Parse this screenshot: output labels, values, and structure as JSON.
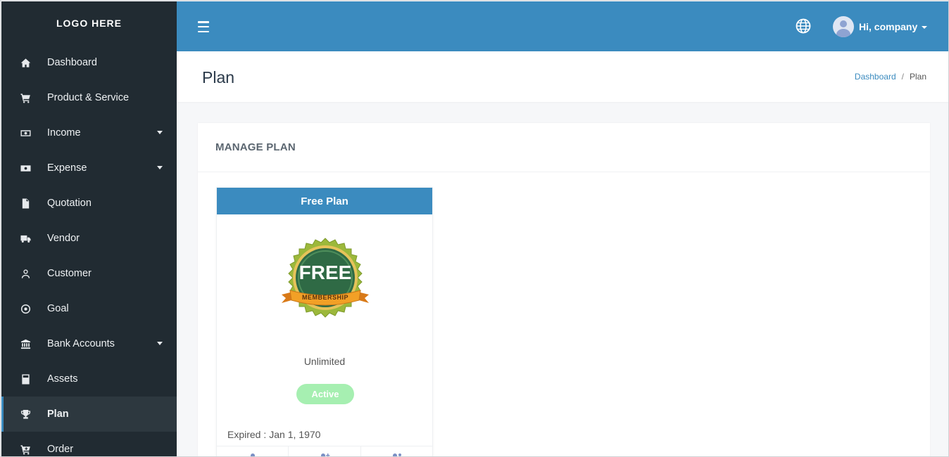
{
  "sidebar": {
    "logo": "LOGO HERE",
    "items": [
      {
        "label": "Dashboard",
        "icon": "home-icon"
      },
      {
        "label": "Product & Service",
        "icon": "cart-icon"
      },
      {
        "label": "Income",
        "icon": "money-icon",
        "has_submenu": true
      },
      {
        "label": "Expense",
        "icon": "money-out-icon",
        "has_submenu": true
      },
      {
        "label": "Quotation",
        "icon": "file-icon"
      },
      {
        "label": "Vendor",
        "icon": "truck-icon"
      },
      {
        "label": "Customer",
        "icon": "user-icon"
      },
      {
        "label": "Goal",
        "icon": "target-icon"
      },
      {
        "label": "Bank Accounts",
        "icon": "bank-icon",
        "has_submenu": true
      },
      {
        "label": "Assets",
        "icon": "calculator-icon"
      },
      {
        "label": "Plan",
        "icon": "trophy-icon",
        "active": true
      },
      {
        "label": "Order",
        "icon": "cart-plus-icon"
      }
    ]
  },
  "topbar": {
    "menu_icon": "hamburger-icon",
    "language_icon": "globe-icon",
    "user_greeting": "Hi, company"
  },
  "page": {
    "title": "Plan",
    "breadcrumb": [
      "Dashboard",
      "Plan"
    ]
  },
  "card": {
    "title": "MANAGE PLAN",
    "plan": {
      "name": "Free Plan",
      "badge_text": "FREE",
      "badge_ribbon": "MEMBERSHIP",
      "limit": "Unlimited",
      "status": "Active",
      "expiry_label": "Expired :",
      "expiry_date": "Jan 1, 1970"
    }
  },
  "colors": {
    "sidebar_bg": "#212b32",
    "accent": "#3b8bbf",
    "status_active": "#a6efb1"
  }
}
